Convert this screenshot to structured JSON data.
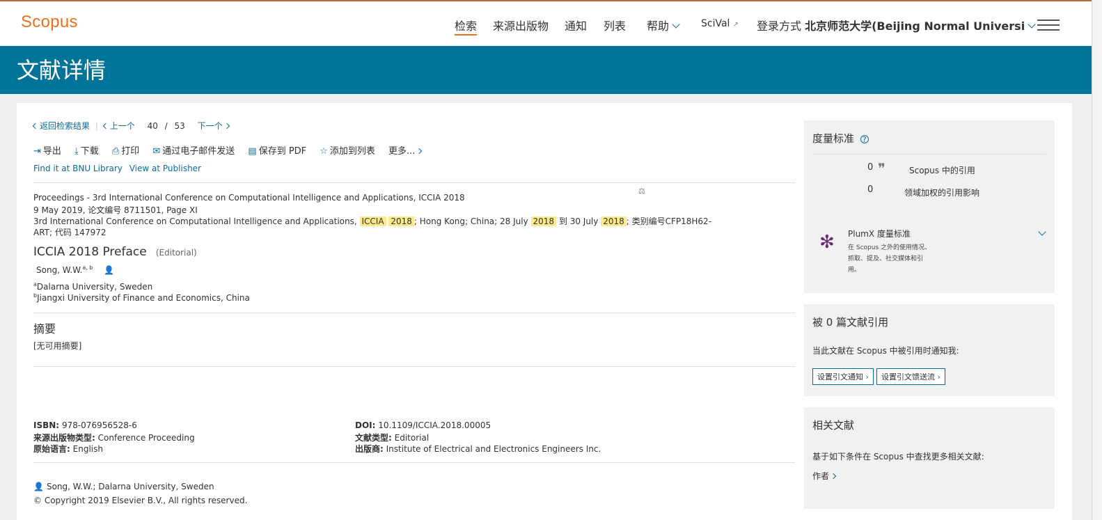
{
  "header": {
    "logo": "Scopus",
    "nav": [
      "检索",
      "来源出版物",
      "通知",
      "列表",
      "帮助",
      "SciVal"
    ],
    "login_prefix": "登录方式",
    "login_institution": "北京师范大学(Beijing Normal Universi"
  },
  "band": {
    "title": "文献详情"
  },
  "pager": {
    "back": "返回检索结果",
    "prev": "上一个",
    "current": "40",
    "sep": "/",
    "total": "53",
    "next": "下一个"
  },
  "toolbar": {
    "export": "导出",
    "download": "下载",
    "print": "打印",
    "email": "通过电子邮件发送",
    "save_pdf": "保存到 PDF",
    "add_list": "添加到列表",
    "more": "更多..."
  },
  "links": {
    "bnu": "Find it at BNU Library",
    "publisher": "View at Publisher"
  },
  "source": {
    "line1": "Proceedings - 3rd International Conference on Computational Intelligence and Applications, ICCIA 2018",
    "line2": "9 May 2019, 论文编号 8711501, Page XI",
    "line3_a": "3rd International Conference on Computational Intelligence and Applications,",
    "hl1": "ICCIA",
    "hl2": "2018",
    "line3_b": "; Hong Kong; China; 28 July",
    "hl3": "2018",
    "line3_c": "到 30 July",
    "hl4": "2018",
    "line3_d": "; 类别编号CFP18H62-",
    "line4": "ART; 代码 147972"
  },
  "article": {
    "title": "ICCIA 2018 Preface",
    "type": "(Editorial)",
    "author": "Song, W.W.",
    "author_sup": "a, b",
    "aff_a_sup": "a",
    "aff_a": "Dalarna University, Sweden",
    "aff_b_sup": "b",
    "aff_b": "Jiangxi University of Finance and Economics, China"
  },
  "abstract": {
    "heading": "摘要",
    "text": "[无可用摘要]"
  },
  "meta": {
    "isbn_label": "ISBN:",
    "isbn": "978-076956528-6",
    "srctype_label": "来源出版物类型:",
    "srctype": "Conference Proceeding",
    "lang_label": "原始语言:",
    "lang": "English",
    "doi_label": "DOI:",
    "doi": "10.1109/ICCIA.2018.00005",
    "doctype_label": "文献类型:",
    "doctype": "Editorial",
    "publisher_label": "出版商:",
    "publisher": "Institute of Electrical and Electronics Engineers Inc."
  },
  "footer": {
    "correspondence": "Song, W.W.; Dalarna University, Sweden",
    "copyright": "© Copyright 2019 Elsevier B.V., All rights reserved."
  },
  "metrics": {
    "heading": "度量标准",
    "cite_count": "0",
    "cite_label": "Scopus 中的引用",
    "fwci_value": "0",
    "fwci_label": "领域加权的引用影响",
    "plumx_title": "PlumX 度量标准",
    "plumx_desc1": "在 Scopus 之外的使用情况、",
    "plumx_desc2": "抓取、提及、社交媒体和引",
    "plumx_desc3": "用。"
  },
  "cited": {
    "heading": "被 0 篇文献引用",
    "desc": "当此文献在 Scopus 中被引用时通知我:",
    "btn_alert": "设置引文通知",
    "btn_feed": "设置引文馈送流"
  },
  "related": {
    "heading": "相关文献",
    "desc": "基于如下条件在 Scopus 中查找更多相关文献:",
    "authors": "作者"
  }
}
